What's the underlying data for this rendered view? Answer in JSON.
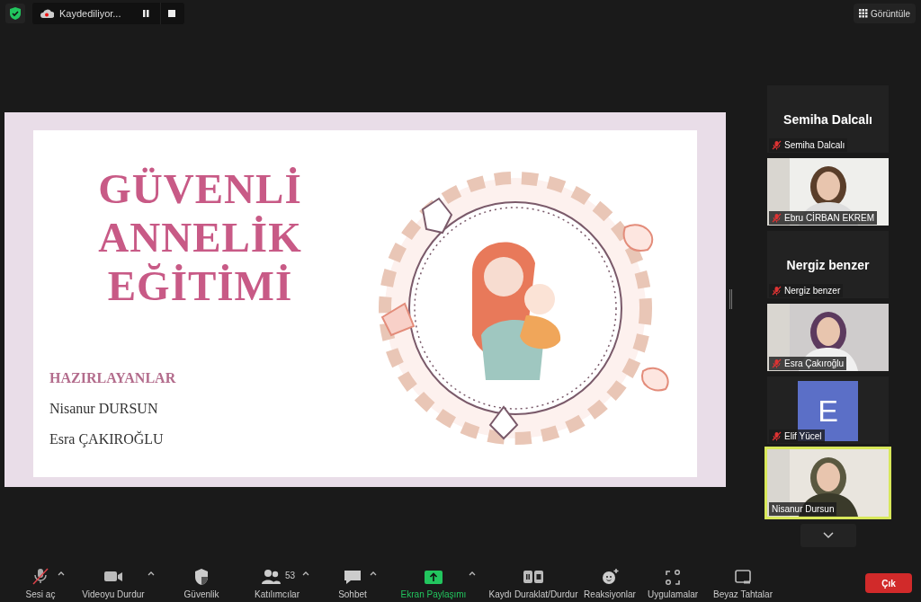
{
  "top_bar": {
    "recording": {
      "label": "Kaydediliyor...",
      "pause": true,
      "stop": true
    },
    "view_button": "Görüntüle"
  },
  "slide": {
    "title_lines": [
      "GÜVENLİ",
      "ANNELİK",
      "EĞİTİMİ"
    ],
    "credits_heading": "HAZIRLAYANLAR",
    "credits": [
      "Nisanur DURSUN",
      "Esra ÇAKIROĞLU"
    ]
  },
  "participants": [
    {
      "kind": "name",
      "display": "Semiha Dalcalı",
      "label": "Semiha Dalcalı",
      "muted": true,
      "speaking": false
    },
    {
      "kind": "video",
      "label": "Ebru CİRBAN EKREM",
      "muted": true,
      "speaking": false
    },
    {
      "kind": "name",
      "display": "Nergiz benzer",
      "label": "Nergiz benzer",
      "muted": true,
      "speaking": false
    },
    {
      "kind": "video",
      "label": "Esra Çakıroğlu",
      "muted": true,
      "speaking": false
    },
    {
      "kind": "avatar",
      "initial": "E",
      "label": "Elif Yücel",
      "muted": true,
      "speaking": false
    },
    {
      "kind": "video",
      "label": "Nisanur Dursun",
      "muted": false,
      "speaking": true
    }
  ],
  "toolbar": [
    {
      "kind": "mic",
      "label": "Sesi aç",
      "caret": true,
      "selected": false
    },
    {
      "kind": "video",
      "label": "Videoyu Durdur",
      "caret": true,
      "selected": false
    },
    {
      "kind": "security",
      "label": "Güvenlik",
      "caret": false,
      "selected": false
    },
    {
      "kind": "participants",
      "label": "Katılımcılar",
      "count": "53",
      "caret": true,
      "selected": false
    },
    {
      "kind": "chat",
      "label": "Sohbet",
      "caret": true,
      "selected": false
    },
    {
      "kind": "share",
      "label": "Ekran Paylaşımı",
      "caret": true,
      "selected": true
    },
    {
      "kind": "record",
      "label": "Kaydı Duraklat/Durdur",
      "caret": false,
      "selected": false
    },
    {
      "kind": "reactions",
      "label": "Reaksiyonlar",
      "caret": false,
      "selected": false
    },
    {
      "kind": "apps",
      "label": "Uygulamalar",
      "caret": false,
      "selected": false
    },
    {
      "kind": "whiteboard",
      "label": "Beyaz Tahtalar",
      "caret": false,
      "selected": false
    }
  ],
  "leave_button": "Çık"
}
